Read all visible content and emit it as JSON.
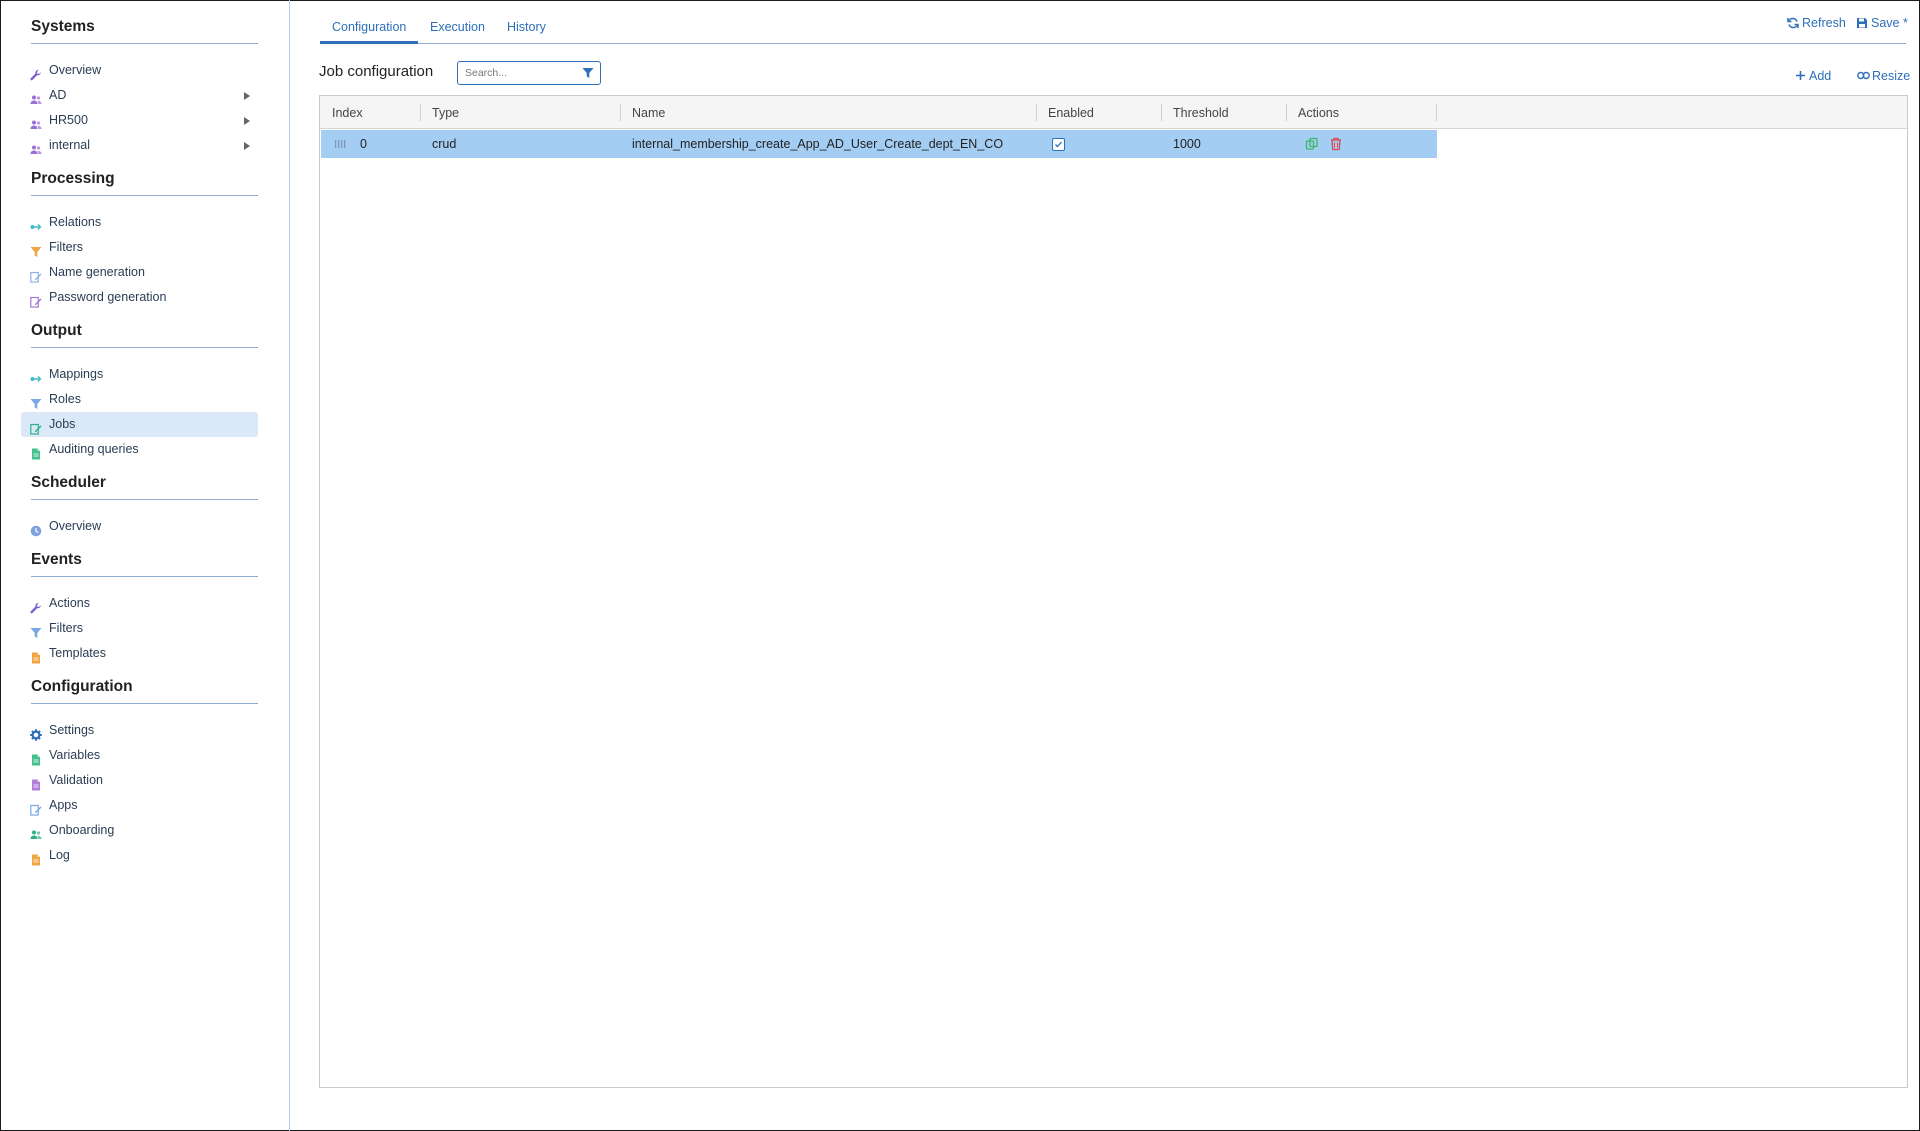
{
  "sidebar": {
    "sections": [
      {
        "title": "Systems",
        "items": [
          {
            "label": "Overview",
            "icon": "wrench-icon",
            "color": "#7b5fd1",
            "submenu": false
          },
          {
            "label": "AD",
            "icon": "users-icon",
            "color": "#9b6fd6",
            "submenu": true
          },
          {
            "label": "HR500",
            "icon": "users-icon",
            "color": "#9b6fd6",
            "submenu": true
          },
          {
            "label": "internal",
            "icon": "users-icon",
            "color": "#9b6fd6",
            "submenu": true
          }
        ]
      },
      {
        "title": "Processing",
        "items": [
          {
            "label": "Relations",
            "icon": "relation-icon",
            "color": "#3fbcc7"
          },
          {
            "label": "Filters",
            "icon": "filter-icon",
            "color": "#f0a542"
          },
          {
            "label": "Name generation",
            "icon": "edit-icon",
            "color": "#8fb3e6"
          },
          {
            "label": "Password generation",
            "icon": "edit-icon",
            "color": "#a278d6"
          }
        ]
      },
      {
        "title": "Output",
        "items": [
          {
            "label": "Mappings",
            "icon": "relation-icon",
            "color": "#3fbcc7"
          },
          {
            "label": "Roles",
            "icon": "filter-icon",
            "color": "#7aa7e4"
          },
          {
            "label": "Jobs",
            "icon": "edit-icon",
            "color": "#2fb08a",
            "active": true
          },
          {
            "label": "Auditing queries",
            "icon": "file-icon",
            "color": "#46c08e"
          }
        ]
      },
      {
        "title": "Scheduler",
        "items": [
          {
            "label": "Overview",
            "icon": "clock-icon",
            "color": "#7ea1e0"
          }
        ]
      },
      {
        "title": "Events",
        "items": [
          {
            "label": "Actions",
            "icon": "wrench-icon",
            "color": "#7b5fd1"
          },
          {
            "label": "Filters",
            "icon": "filter-icon",
            "color": "#7aa7e4"
          },
          {
            "label": "Templates",
            "icon": "file-icon",
            "color": "#f0a542"
          }
        ]
      },
      {
        "title": "Configuration",
        "items": [
          {
            "label": "Settings",
            "icon": "gear-icon",
            "color": "#2e6fb9"
          },
          {
            "label": "Variables",
            "icon": "file-icon",
            "color": "#46c08e"
          },
          {
            "label": "Validation",
            "icon": "file-icon",
            "color": "#b07ed9"
          },
          {
            "label": "Apps",
            "icon": "edit-icon",
            "color": "#7aa7e4"
          },
          {
            "label": "Onboarding",
            "icon": "users-icon",
            "color": "#2fb08a"
          },
          {
            "label": "Log",
            "icon": "file-icon",
            "color": "#f0a542"
          }
        ]
      }
    ]
  },
  "tabs": [
    {
      "label": "Configuration",
      "active": true
    },
    {
      "label": "Execution",
      "active": false
    },
    {
      "label": "History",
      "active": false
    }
  ],
  "toolbar": {
    "refresh_label": "Refresh",
    "save_label": "Save *",
    "add_label": "Add",
    "resize_label": "Resize"
  },
  "job_config": {
    "title": "Job configuration",
    "search_placeholder": "Search..."
  },
  "table": {
    "columns": [
      "Index",
      "Type",
      "Name",
      "Enabled",
      "Threshold",
      "Actions"
    ],
    "rows": [
      {
        "index": "0",
        "type": "crud",
        "name": "internal_membership_create_App_AD_User_Create_dept_EN_CO",
        "enabled": true,
        "threshold": "1000"
      }
    ]
  },
  "colors": {
    "accent": "#2e6fb9",
    "row_selected": "#a3cdf3",
    "copy_action": "#3fb66b",
    "delete_action": "#e0464f"
  }
}
